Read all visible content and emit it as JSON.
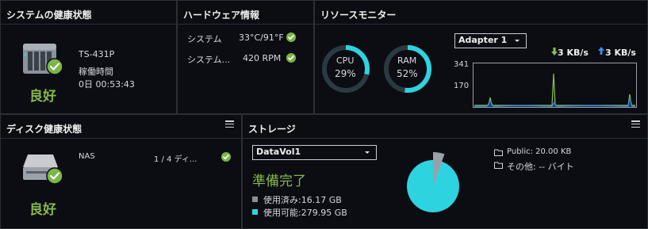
{
  "system_health": {
    "title": "システムの健康状態",
    "model": "TS-431P",
    "uptime_label": "稼働時間",
    "uptime_value": "0日 00:53:43",
    "status": "良好"
  },
  "hardware": {
    "title": "ハードウェア情報",
    "rows": [
      {
        "label": "システム",
        "value": "33°C/91°F"
      },
      {
        "label": "システム...",
        "value": "420 RPM"
      }
    ]
  },
  "resource": {
    "title": "リソースモニター",
    "adapter": "Adapter 1",
    "cpu": {
      "label": "CPU",
      "value": "29%",
      "percent": 29
    },
    "ram": {
      "label": "RAM",
      "value": "52%",
      "percent": 52
    },
    "download": "3 KB/s",
    "upload": "3 KB/s",
    "ytick_top": "341",
    "ytick_mid": "170"
  },
  "disk": {
    "title": "ディスク健康状態",
    "name": "NAS",
    "count": "1 / 4 ディ...",
    "status": "良好"
  },
  "storage": {
    "title": "ストレージ",
    "volume": "DataVol1",
    "status": "準備完了",
    "used": "使用済み:16.17 GB",
    "available": "使用可能:279.95 GB",
    "used_fraction": 0.0546,
    "public": "Public: 20.00 KB",
    "other": "その他: -- バイト"
  },
  "colors": {
    "accent_cyan": "#2ed3e0",
    "ok_green": "#7ab648",
    "status_green": "#86b84c",
    "upload_blue": "#3b8de0",
    "download_green": "#8fc14a"
  }
}
